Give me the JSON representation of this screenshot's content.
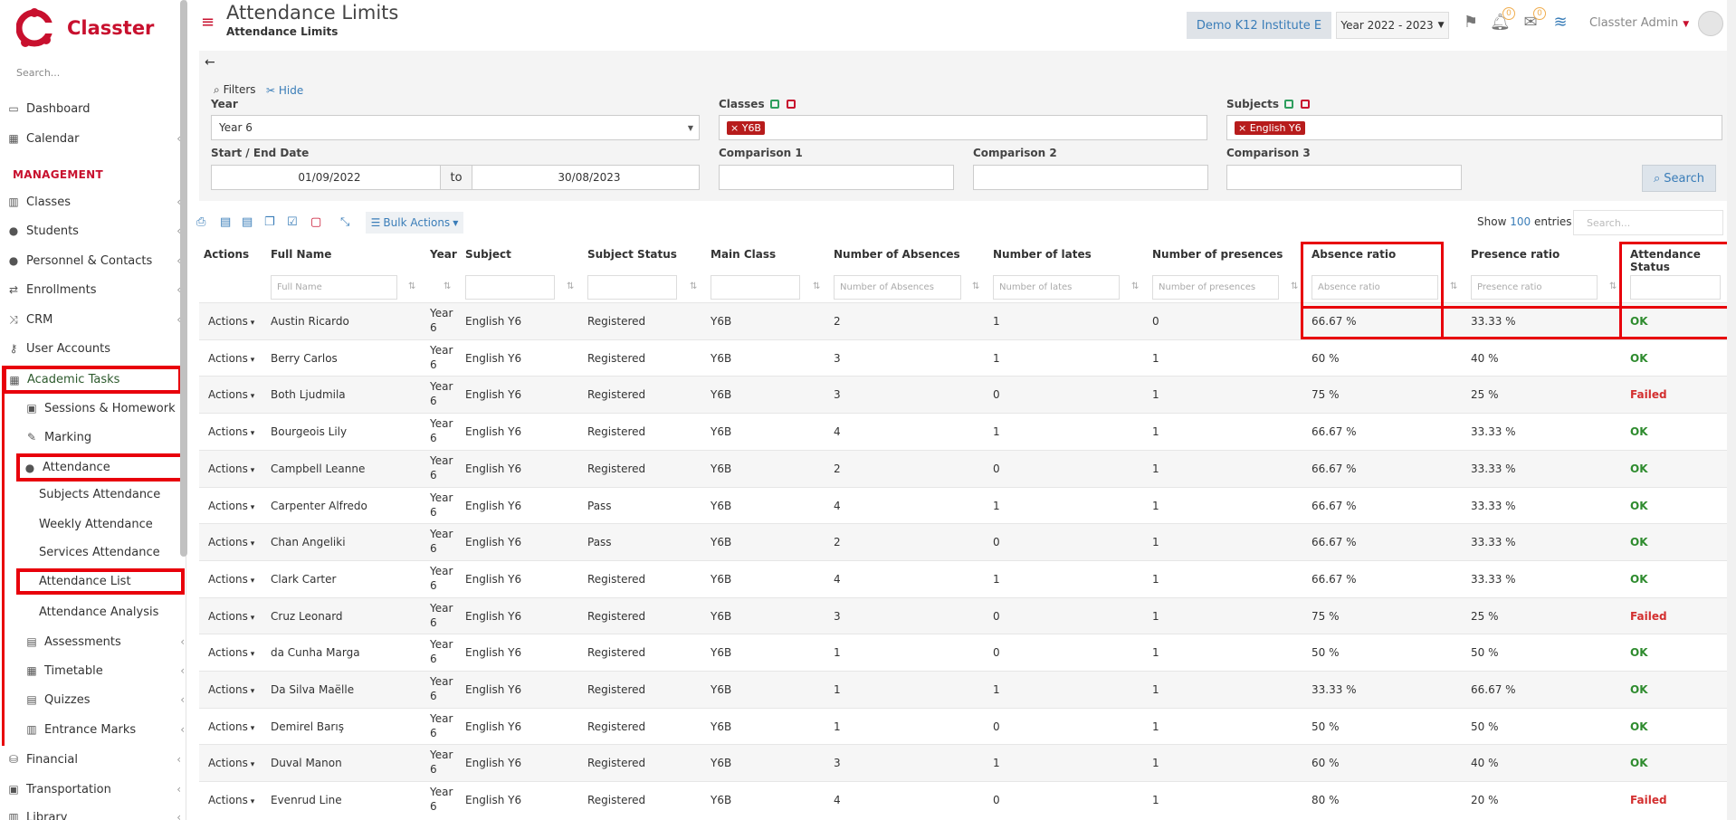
{
  "app": {
    "name": "Classter"
  },
  "sidebar": {
    "search_placeholder": "Search...",
    "section_management": "MANAGEMENT",
    "items": [
      {
        "label": "Dashboard",
        "icon": "monitor-icon"
      },
      {
        "label": "Calendar",
        "icon": "calendar-icon"
      },
      {
        "label": "Classes",
        "icon": "classes-icon"
      },
      {
        "label": "Students",
        "icon": "students-icon"
      },
      {
        "label": "Personnel & Contacts",
        "icon": "person-icon"
      },
      {
        "label": "Enrollments",
        "icon": "exchange-icon"
      },
      {
        "label": "CRM",
        "icon": "shuffle-icon"
      },
      {
        "label": "User Accounts",
        "icon": "key-icon"
      },
      {
        "label": "Academic Tasks",
        "icon": "grid-icon"
      },
      {
        "label": "Sessions & Homework",
        "icon": "sessions-icon"
      },
      {
        "label": "Marking",
        "icon": "edit-icon"
      },
      {
        "label": "Attendance",
        "icon": "attendance-icon"
      },
      {
        "label": "Subjects Attendance"
      },
      {
        "label": "Weekly Attendance"
      },
      {
        "label": "Services Attendance"
      },
      {
        "label": "Attendance List"
      },
      {
        "label": "Attendance Analysis"
      },
      {
        "label": "Assessments",
        "icon": "assessments-icon"
      },
      {
        "label": "Timetable",
        "icon": "timetable-icon"
      },
      {
        "label": "Quizzes",
        "icon": "quizzes-icon"
      },
      {
        "label": "Entrance Marks",
        "icon": "marks-icon"
      },
      {
        "label": "Financial",
        "icon": "coins-icon"
      },
      {
        "label": "Transportation",
        "icon": "bus-icon"
      },
      {
        "label": "Library",
        "icon": "library-icon"
      }
    ]
  },
  "header": {
    "title": "Attendance Limits",
    "subtitle": "Attendance Limits",
    "school": "Demo K12 Institute E",
    "year": "Year 2022 - 2023",
    "notif_count": "0",
    "msg_count": "0",
    "user": "Classter Admin"
  },
  "filters": {
    "filters_label": "Filters",
    "hide_label": "Hide",
    "year_label": "Year",
    "year_value": "Year 6",
    "classes_label": "Classes",
    "classes_tag": "Y6B",
    "subjects_label": "Subjects",
    "subjects_tag": "English Y6",
    "date_label": "Start / End Date",
    "start_date": "01/09/2022",
    "to_label": "to",
    "end_date": "30/08/2023",
    "comp1_label": "Comparison 1",
    "comp2_label": "Comparison 2",
    "comp3_label": "Comparison 3",
    "search_label": "Search"
  },
  "toolbar": {
    "bulk_label": "Bulk Actions",
    "show_label": "Show",
    "show_count": "100",
    "entries_label": "entries",
    "search_placeholder": "Search..."
  },
  "table": {
    "columns": [
      "Actions",
      "Full Name",
      "Year",
      "Subject",
      "Subject Status",
      "Main Class",
      "Number of Absences",
      "Number of lates",
      "Number of presences",
      "Absence ratio",
      "Presence ratio",
      "Attendance Status"
    ],
    "filter_placeholders": {
      "full_name": "Full Name",
      "absences": "Number of Absences",
      "lates": "Number of lates",
      "presences": "Number of presences",
      "absence_ratio": "Absence ratio",
      "presence_ratio": "Presence ratio"
    },
    "action_label": "Actions",
    "rows": [
      {
        "name": "Austin Ricardo",
        "year": "Year 6",
        "subject": "English Y6",
        "status": "Registered",
        "class": "Y6B",
        "absences": "2",
        "lates": "1",
        "presences": "0",
        "abs_ratio": "66.67 %",
        "pres_ratio": "33.33 %",
        "att": "OK"
      },
      {
        "name": "Berry Carlos",
        "year": "Year 6",
        "subject": "English Y6",
        "status": "Registered",
        "class": "Y6B",
        "absences": "3",
        "lates": "1",
        "presences": "1",
        "abs_ratio": "60 %",
        "pres_ratio": "40 %",
        "att": "OK"
      },
      {
        "name": "Both Ljudmila",
        "year": "Year 6",
        "subject": "English Y6",
        "status": "Registered",
        "class": "Y6B",
        "absences": "3",
        "lates": "0",
        "presences": "1",
        "abs_ratio": "75 %",
        "pres_ratio": "25 %",
        "att": "Failed"
      },
      {
        "name": "Bourgeois Lily",
        "year": "Year 6",
        "subject": "English Y6",
        "status": "Registered",
        "class": "Y6B",
        "absences": "4",
        "lates": "1",
        "presences": "1",
        "abs_ratio": "66.67 %",
        "pres_ratio": "33.33 %",
        "att": "OK"
      },
      {
        "name": "Campbell Leanne",
        "year": "Year 6",
        "subject": "English Y6",
        "status": "Registered",
        "class": "Y6B",
        "absences": "2",
        "lates": "0",
        "presences": "1",
        "abs_ratio": "66.67 %",
        "pres_ratio": "33.33 %",
        "att": "OK"
      },
      {
        "name": "Carpenter Alfredo",
        "year": "Year 6",
        "subject": "English Y6",
        "status": "Pass",
        "class": "Y6B",
        "absences": "4",
        "lates": "1",
        "presences": "1",
        "abs_ratio": "66.67 %",
        "pres_ratio": "33.33 %",
        "att": "OK"
      },
      {
        "name": "Chan Angeliki",
        "year": "Year 6",
        "subject": "English Y6",
        "status": "Pass",
        "class": "Y6B",
        "absences": "2",
        "lates": "0",
        "presences": "1",
        "abs_ratio": "66.67 %",
        "pres_ratio": "33.33 %",
        "att": "OK"
      },
      {
        "name": "Clark Carter",
        "year": "Year 6",
        "subject": "English Y6",
        "status": "Registered",
        "class": "Y6B",
        "absences": "4",
        "lates": "1",
        "presences": "1",
        "abs_ratio": "66.67 %",
        "pres_ratio": "33.33 %",
        "att": "OK"
      },
      {
        "name": "Cruz Leonard",
        "year": "Year 6",
        "subject": "English Y6",
        "status": "Registered",
        "class": "Y6B",
        "absences": "3",
        "lates": "0",
        "presences": "1",
        "abs_ratio": "75 %",
        "pres_ratio": "25 %",
        "att": "Failed"
      },
      {
        "name": "da Cunha Marga",
        "year": "Year 6",
        "subject": "English Y6",
        "status": "Registered",
        "class": "Y6B",
        "absences": "1",
        "lates": "0",
        "presences": "1",
        "abs_ratio": "50 %",
        "pres_ratio": "50 %",
        "att": "OK"
      },
      {
        "name": "Da Silva Maëlle",
        "year": "Year 6",
        "subject": "English Y6",
        "status": "Registered",
        "class": "Y6B",
        "absences": "1",
        "lates": "1",
        "presences": "1",
        "abs_ratio": "33.33 %",
        "pres_ratio": "66.67 %",
        "att": "OK"
      },
      {
        "name": "Demirel Barış",
        "year": "Year 6",
        "subject": "English Y6",
        "status": "Registered",
        "class": "Y6B",
        "absences": "1",
        "lates": "0",
        "presences": "1",
        "abs_ratio": "50 %",
        "pres_ratio": "50 %",
        "att": "OK"
      },
      {
        "name": "Duval Manon",
        "year": "Year 6",
        "subject": "English Y6",
        "status": "Registered",
        "class": "Y6B",
        "absences": "3",
        "lates": "1",
        "presences": "1",
        "abs_ratio": "60 %",
        "pres_ratio": "40 %",
        "att": "OK"
      },
      {
        "name": "Evenrud Line",
        "year": "Year 6",
        "subject": "English Y6",
        "status": "Registered",
        "class": "Y6B",
        "absences": "4",
        "lates": "0",
        "presences": "1",
        "abs_ratio": "80 %",
        "pres_ratio": "20 %",
        "att": "Failed"
      }
    ]
  },
  "colors": {
    "brand": "#c8102e",
    "link": "#3a7db8",
    "ok": "#2e8b2e",
    "failed": "#d32f2f",
    "highlight": "#e8000b"
  }
}
